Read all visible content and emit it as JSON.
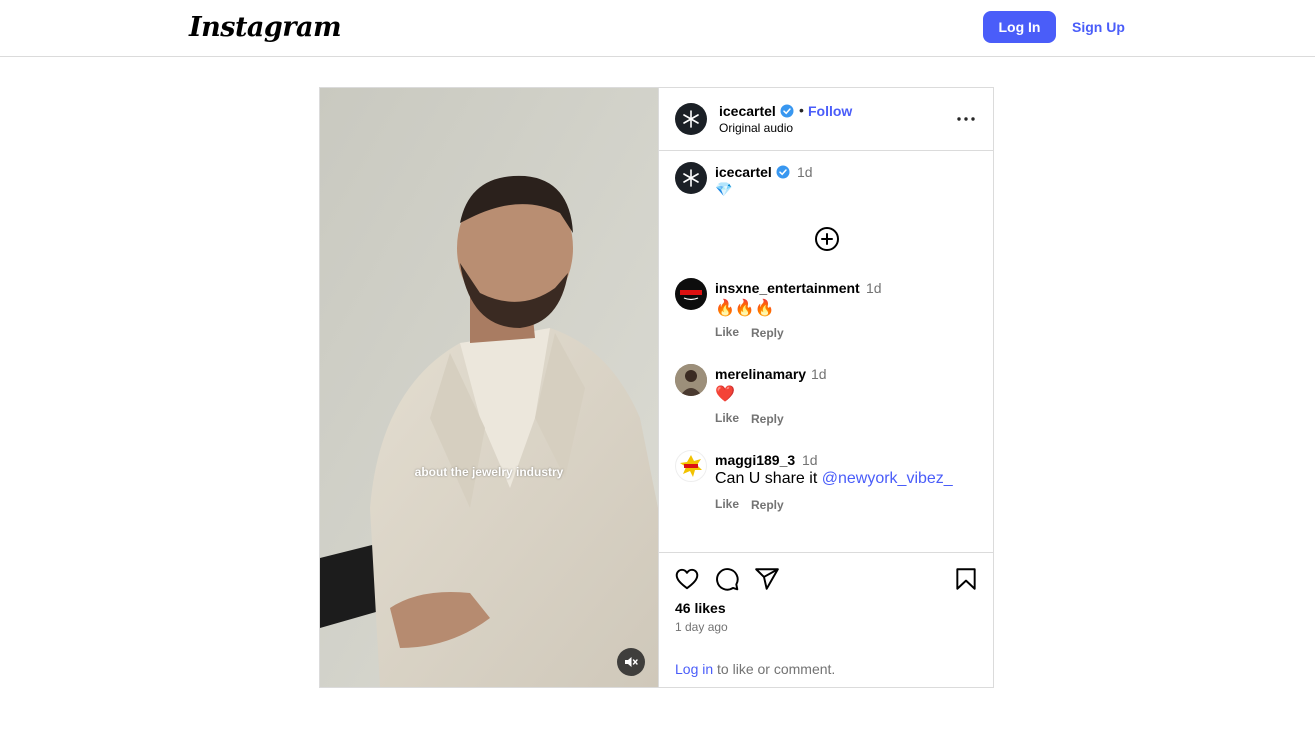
{
  "nav": {
    "logo": "Instagram",
    "login_label": "Log In",
    "signup_label": "Sign Up"
  },
  "colors": {
    "accent": "#4a5df9",
    "muted": "#737373",
    "border": "#dbdbdb"
  },
  "media": {
    "caption_overlay": "about the jewelry industry",
    "mute_icon": "speaker-muted-icon"
  },
  "header": {
    "username": "icecartel",
    "separator": "•",
    "follow_label": "Follow",
    "audio": "Original audio",
    "more_icon": "more-options-icon"
  },
  "caption": {
    "username": "icecartel",
    "time": "1d",
    "text": "💎"
  },
  "comments": [
    {
      "username": "insxne_entertainment",
      "time": "1d",
      "text": "🔥🔥🔥",
      "like": "Like",
      "reply": "Reply"
    },
    {
      "username": "merelinamary",
      "time": "1d",
      "text": "❤️",
      "like": "Like",
      "reply": "Reply"
    },
    {
      "username": "maggi189_3",
      "time": "1d",
      "text": "Can U share it ",
      "mention": "@newyork_vibez_",
      "like": "Like",
      "reply": "Reply"
    }
  ],
  "engagement": {
    "likes": "46 likes",
    "ago": "1 day ago",
    "login_link": "Log in",
    "login_rest": " to like or comment.",
    "icons": [
      "heart-icon",
      "comment-icon",
      "share-icon",
      "bookmark-icon"
    ]
  }
}
